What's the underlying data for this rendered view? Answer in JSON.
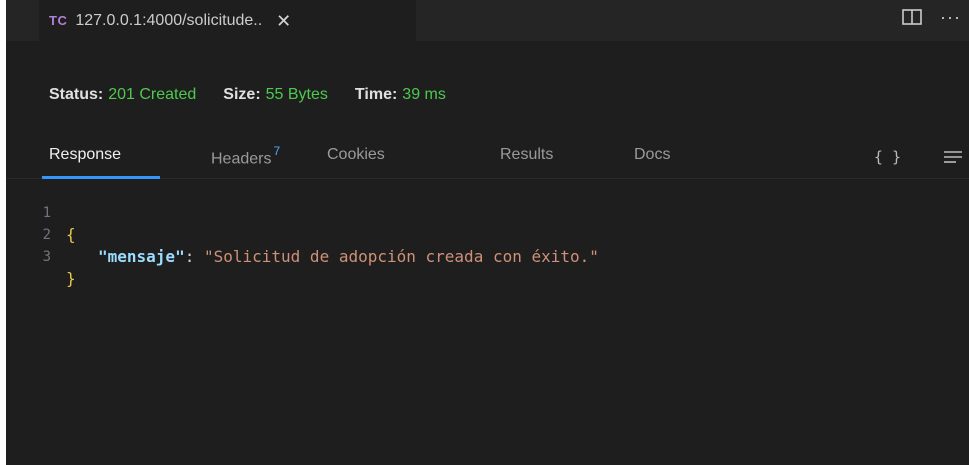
{
  "tab": {
    "icon_text": "TC",
    "title": "127.0.0.1:4000/solicitude..",
    "close_glyph": "✕"
  },
  "toolbar": {
    "more_glyph": "···"
  },
  "status": {
    "status_label": "Status:",
    "status_value": "201 Created",
    "size_label": "Size:",
    "size_value": "55 Bytes",
    "time_label": "Time:",
    "time_value": "39 ms"
  },
  "response_tabs": [
    {
      "label": "Response",
      "active": true
    },
    {
      "label": "Headers",
      "badge": "7",
      "active": false
    },
    {
      "label": "Cookies",
      "active": false
    },
    {
      "label": "Results",
      "active": false
    },
    {
      "label": "Docs",
      "active": false
    }
  ],
  "format_glyph": "{ }",
  "editor": {
    "lines": [
      {
        "number": "1",
        "text": "{"
      },
      {
        "number": "2",
        "key": "\"mensaje\"",
        "colon": ": ",
        "value": "\"Solicitud de adopción creada con éxito.\""
      },
      {
        "number": "3",
        "text": "}"
      }
    ]
  },
  "colors": {
    "background": "#1e1e1e",
    "status_green": "#4ec94e",
    "accent_blue": "#3794ff",
    "json_key": "#9cdcfe",
    "json_string": "#ce9178",
    "brace": "#e6c84f"
  }
}
